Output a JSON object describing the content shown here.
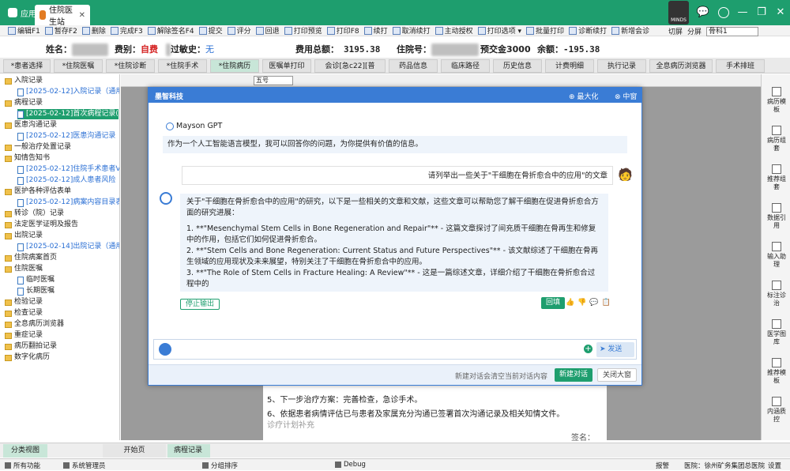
{
  "titlebar": {
    "tabs": [
      {
        "label": "应用"
      },
      {
        "label": "住院医生站",
        "close": "✕"
      }
    ],
    "logo_text": "MINDS",
    "window_buttons": [
      "—",
      "❐",
      "✕"
    ]
  },
  "toolbar": {
    "buttons": [
      "编辑F1",
      "暂存F2",
      "删除",
      "完成F3",
      "解除签名F4",
      "提交",
      "评分",
      "回退",
      "打印预览",
      "打印F8",
      "续打",
      "取消续打",
      "主动授权",
      "打印选项 ▾",
      "批量打印",
      "诊断续打",
      "新增会诊"
    ],
    "right": {
      "cut_label": "切屏",
      "split_label": "分屏",
      "dept_value": "骨科1"
    }
  },
  "patient": {
    "name_label": "姓名：",
    "fee_type_label": "费别：",
    "fee_type_value": "自费",
    "allergy_label": "过敏史：",
    "allergy_value": "无",
    "total_label": "费用总额：",
    "total_value": "3195.38",
    "inpatient_no_label": "住院号：",
    "deposit_label": "预交金3000",
    "balance_label": "余额：",
    "balance_value": "-195.38"
  },
  "module_tabs": [
    "*患者选择",
    "*住院医嘱",
    "*住院诊断",
    "*住院手术",
    "*住院病历",
    "医嘱单打印",
    "会诊[急c22][普1276]",
    "药品信息",
    "临床路径",
    "历史信息",
    "计费明细",
    "执行记录",
    "全息病历浏览器",
    "手术排班"
  ],
  "tree": {
    "items": [
      {
        "label": "入院记录",
        "type": "folder",
        "level": 0
      },
      {
        "label": "[2025-02-12]入院记录（通用",
        "type": "doc",
        "level": 1
      },
      {
        "label": "病程记录",
        "type": "folder",
        "level": 0
      },
      {
        "label": "[2025-02-12]首次病程记录(",
        "type": "doc",
        "level": 1,
        "selected": true
      },
      {
        "label": "医患沟通记录",
        "type": "folder",
        "level": 0
      },
      {
        "label": "[2025-02-12]医患沟通记录（",
        "type": "doc",
        "level": 1
      },
      {
        "label": "一般治疗处置记录",
        "type": "folder",
        "level": 0
      },
      {
        "label": "知情告知书",
        "type": "folder",
        "level": 0
      },
      {
        "label": "[2025-02-12]住院手术患者V",
        "type": "doc",
        "level": 1
      },
      {
        "label": "[2025-02-12]成人患者风险",
        "type": "doc",
        "level": 1
      },
      {
        "label": "医护各种评估表单",
        "type": "folder",
        "level": 0
      },
      {
        "label": "[2025-02-12]病案内容目录表",
        "type": "doc",
        "level": 1
      },
      {
        "label": "转诊（院）记录",
        "type": "folder",
        "level": 0
      },
      {
        "label": "法定医学证明及报告",
        "type": "folder",
        "level": 0
      },
      {
        "label": "出院记录",
        "type": "folder",
        "level": 0
      },
      {
        "label": "[2025-02-14]出院记录（通用",
        "type": "doc",
        "level": 1
      },
      {
        "label": "住院病案首页",
        "type": "folder",
        "level": 0
      },
      {
        "label": "住院医嘱",
        "type": "folder",
        "level": 0
      },
      {
        "label": "临时医嘱",
        "type": "doc",
        "level": 1,
        "plain": true
      },
      {
        "label": "长期医嘱",
        "type": "doc",
        "level": 1,
        "plain": true
      },
      {
        "label": "检验记录",
        "type": "folder",
        "level": 0
      },
      {
        "label": "检查记录",
        "type": "folder",
        "level": 0
      },
      {
        "label": "全息病历浏览器",
        "type": "folder",
        "level": 0
      },
      {
        "label": "重症记录",
        "type": "folder",
        "level": 0
      },
      {
        "label": "病历翻拍记录",
        "type": "folder",
        "level": 0
      },
      {
        "label": "数字化病历",
        "type": "folder",
        "level": 0
      }
    ]
  },
  "editor": {
    "font_size": "五号",
    "lines": [
      "5、下一步治疗方案：完善检查，急诊手术。",
      "6、依据患者病情评估已与患者及家属充分沟通已签署首次沟通记录及相关知情文件。",
      "诊疗计划补充"
    ],
    "signature_fragment": "签名："
  },
  "right_panel": [
    "病历模板",
    "病历组套",
    "推荐组套",
    "数据引用",
    "输入助理",
    "标注诊治",
    "医学图库",
    "推荐模板",
    "内涵质控"
  ],
  "dialog": {
    "brand": "墨智科技",
    "maximize_label": "最大化",
    "minimize_label": "中窗",
    "bot_name": "Mayson GPT",
    "bot_intro": "作为一个人工智能语言模型，我可以回答你的问题，为你提供有价值的信息。",
    "user_question": "请列举出一些关于\"干细胞在骨折愈合中的应用\"的文章",
    "answer_intro": "关于\"干细胞在骨折愈合中的应用\"的研究，以下是一些相关的文章和文献，这些文章可以帮助您了解干细胞在促进骨折愈合方面的研究进展：",
    "answer_items": [
      "1. **\"Mesenchymal Stem Cells in Bone Regeneration and Repair\"** - 这篇文章探讨了间充质干细胞在骨再生和修复中的作用，包括它们如何促进骨折愈合。",
      "2. **\"Stem Cells and Bone Regeneration: Current Status and Future Perspectives\"** - 该文献综述了干细胞在骨再生领域的应用现状及未来展望，特别关注了干细胞在骨折愈合中的应用。",
      "3. **\"The Role of Stem Cells in Fracture Healing: A Review\"** - 这是一篇综述文章，详细介绍了干细胞在骨折愈合过程中的"
    ],
    "stop_label": "停止输出",
    "writeback_label": "回填",
    "send_label": "发送",
    "input_placeholder": "",
    "footer_hint": "新建对话会清空当前对话内容",
    "new_chat_label": "新建对话",
    "close_label": "关闭大窗"
  },
  "bottom_tabs": {
    "left": "分类视图",
    "tabs": [
      {
        "label": "开始页"
      },
      {
        "label": "病程记录",
        "close": "✕"
      }
    ]
  },
  "status": {
    "all_functions": "所有功能",
    "admin": "系统管理员",
    "sort": "分组排序",
    "debug": "Debug",
    "alarm": "报警",
    "hospital_label": "医院：",
    "hospital_name": "徐州矿务集团总医院",
    "settings": "设置"
  },
  "colors": {
    "brand_green": "#1e9e6e",
    "dialog_blue": "#3a7cd5",
    "link_blue": "#2a6fd4",
    "red_text": "#d42020"
  }
}
